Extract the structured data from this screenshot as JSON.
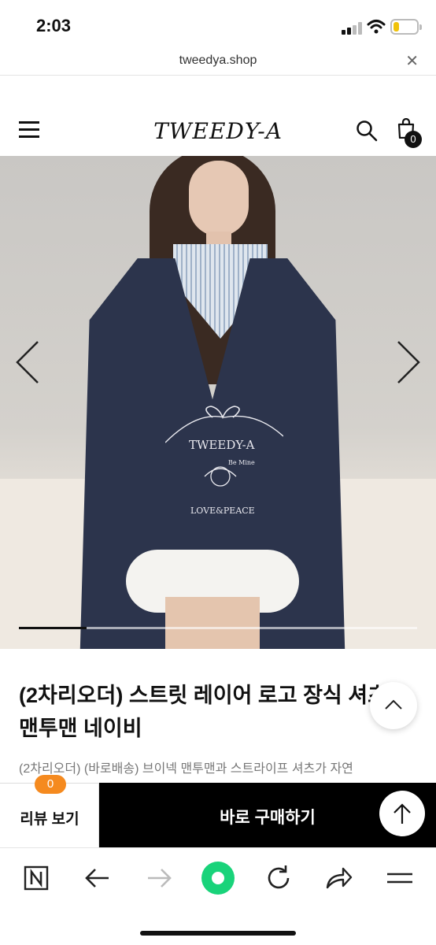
{
  "status_bar": {
    "time": "2:03",
    "battery_level": 0.25,
    "battery_color": "#f0c20a"
  },
  "browser": {
    "url": "tweedya.shop",
    "close_icon": "close-icon"
  },
  "site": {
    "logo": "TWEEDY-A",
    "cart_count": "0"
  },
  "carousel": {
    "progress": 0.17,
    "print_lines": [
      "TWEEDY-A",
      "Be Mine",
      "LOVE&PEACE"
    ]
  },
  "product": {
    "title": "(2차리오더) 스트릿 레이어 로고 장식 셔츠 맨투맨 네이비",
    "description": "(2차리오더) (바로배송) 브이넥 맨투맨과 스트라이프 셔츠가 자연"
  },
  "bottom_bar": {
    "review_label": "리뷰 보기",
    "review_count": "0",
    "buy_label": "바로 구매하기",
    "accent_color": "#f58a1f"
  },
  "colors": {
    "toolbar_center": "#19d37a"
  }
}
